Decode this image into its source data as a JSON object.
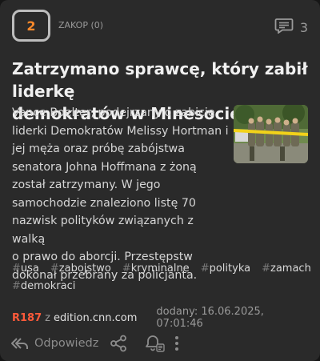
{
  "vote": {
    "count": "2",
    "bury_label": "ZAKOP (0)"
  },
  "comments": {
    "count": "3",
    "icon": "comment-icon"
  },
  "article": {
    "title_line1": "Zatrzymano sprawcę, który zabił liderkę",
    "title_line2": "demokratów w Minesocie",
    "description_lines": [
      "Vance Boelter, podejrzany o zabicie",
      "liderki Demokratów Melissy Hortman i",
      "jej męża oraz próbę zabójstwa",
      "senatora Johna Hoffmana z żoną",
      "został zatrzymany. W jego",
      "samochodzie znaleziono listę 70",
      "nazwisk polityków związanych z walką",
      "o prawo do aborcji. Przestępstw",
      "dokonał przebrany za policjanta."
    ]
  },
  "tags": [
    {
      "hash": "#",
      "text": "usa"
    },
    {
      "hash": "#",
      "text": "zabojstwo"
    },
    {
      "hash": "#",
      "text": "kryminalne"
    },
    {
      "hash": "#",
      "text": "polityka"
    },
    {
      "hash": "#",
      "text": "zamach"
    },
    {
      "hash": "#",
      "text": "demokraci"
    }
  ],
  "meta": {
    "rank": "R187",
    "source_prefix": "z",
    "source": "edition.cnn.com",
    "added": "dodany: 16.06.2025, 07:01:46"
  },
  "actions": {
    "reply_label": "Odpowiedz",
    "icons": [
      "reply-icon",
      "share-icon",
      "notify-icon",
      "more-icon"
    ]
  },
  "colors": {
    "accent_orange": "#ff8a2a",
    "rank_red": "#ff5a3a",
    "card_bg": "#2a2a2a"
  }
}
